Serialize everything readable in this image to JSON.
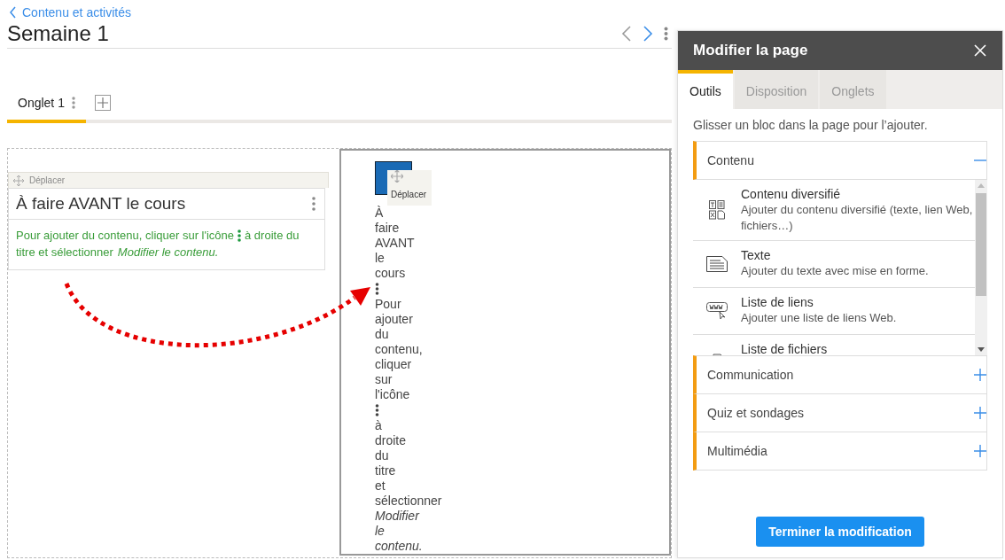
{
  "breadcrumb": {
    "label": "Contenu et activités"
  },
  "page": {
    "title": "Semaine 1"
  },
  "tabs": [
    {
      "label": "Onglet 1",
      "selected": true
    }
  ],
  "block": {
    "move_label": "Déplacer",
    "title": "À faire AVANT le cours",
    "body_before": "Pour ajouter du contenu, cliquer sur l'icône",
    "body_after": "à droite du",
    "body_end": "titre et sélectionner",
    "body_link": "Modifier le contenu."
  },
  "dragged_block": {
    "move_label": "Déplacer",
    "title": "À faire AVANT le cours",
    "body_before": "Pour ajouter du contenu, cliquer sur l'icône",
    "body_after": "à droite du",
    "body_end": "titre et sélectionner",
    "body_link": "Modifier le contenu."
  },
  "panel": {
    "title": "Modifier la page",
    "tabs": [
      {
        "label": "Outils",
        "selected": true
      },
      {
        "label": "Disposition",
        "selected": false
      },
      {
        "label": "Onglets",
        "selected": false
      }
    ],
    "hint": "Glisser un bloc dans la page pour l’ajouter.",
    "sections": [
      {
        "label": "Contenu",
        "expanded": true,
        "items": [
          {
            "kind": "diverse",
            "title": "Contenu diversifié",
            "description": "Ajouter du contenu diversifié (texte, lien Web, fichiers…)"
          },
          {
            "kind": "text",
            "title": "Texte",
            "description": "Ajouter du texte avec mise en forme."
          },
          {
            "kind": "links",
            "title": "Liste de liens",
            "description": "Ajouter une liste de liens Web."
          },
          {
            "kind": "files",
            "title": "Liste de fichiers"
          }
        ]
      },
      {
        "label": "Communication",
        "expanded": false
      },
      {
        "label": "Quiz et sondages",
        "expanded": false
      },
      {
        "label": "Multimédia",
        "expanded": false
      }
    ],
    "button": "Terminer la modification"
  }
}
